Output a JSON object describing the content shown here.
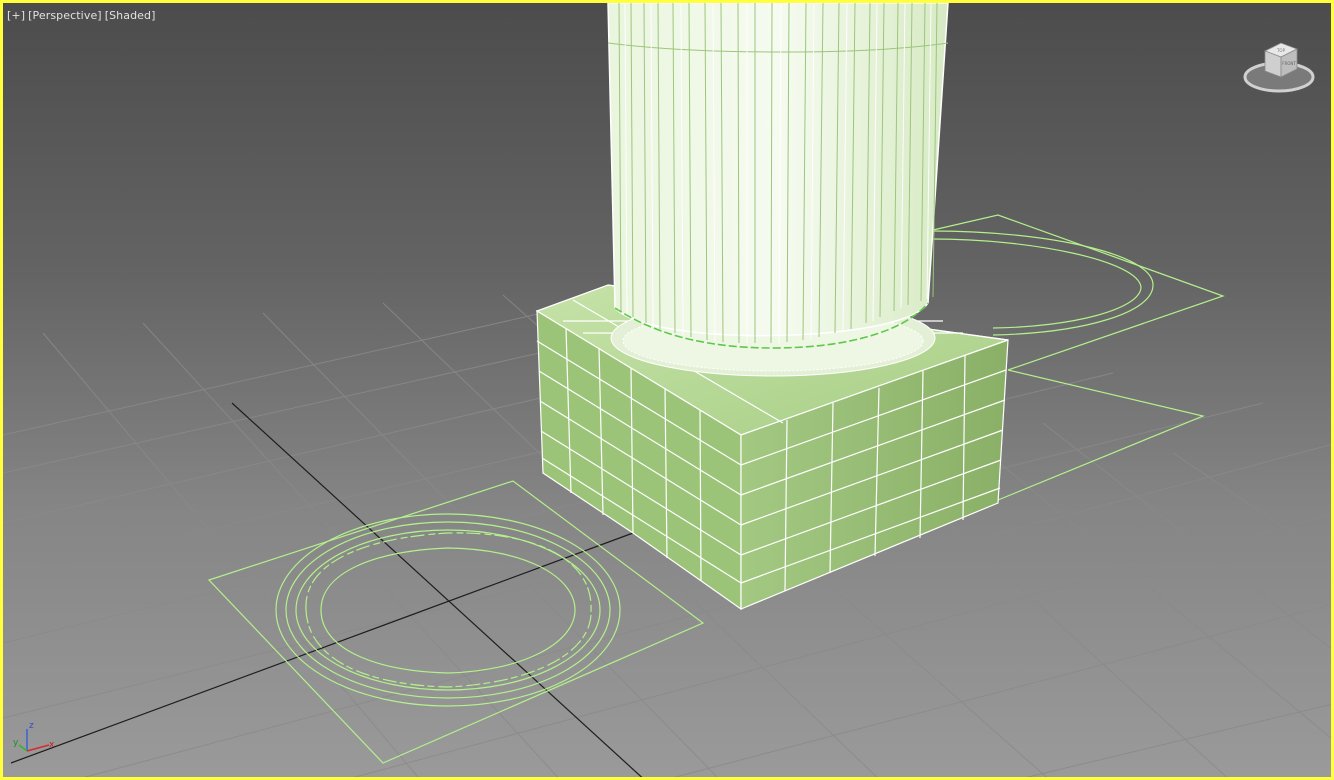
{
  "viewport": {
    "menu_label": "[+]",
    "view_label": "[Perspective]",
    "shading_label": "[Shaded]",
    "active_border_color": "#ffff3c",
    "selection_wire_color": "#aaf08a",
    "object_color": "#8fb56b"
  },
  "viewcube": {
    "top_face": "TOP",
    "front_face": "FRONT"
  },
  "axis_tripod": {
    "z": "z",
    "y": "y",
    "x": "x"
  }
}
